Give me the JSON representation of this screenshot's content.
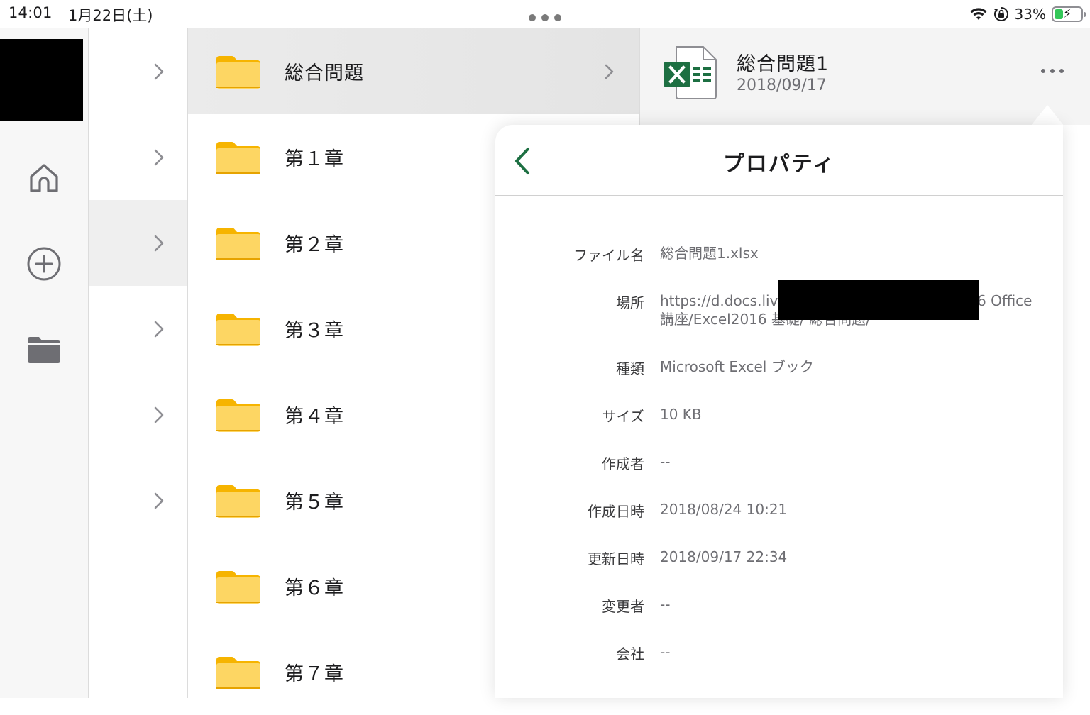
{
  "status_bar": {
    "time": "14:01",
    "date": "1月22日(土)",
    "battery_percent": "33%",
    "battery_level": 0.33,
    "battery_color": "#34c759",
    "icons": [
      "wifi-icon",
      "orientation-lock-icon",
      "battery-charging-icon"
    ]
  },
  "rail": {
    "icons": [
      "home-icon",
      "add-icon",
      "folder-icon"
    ]
  },
  "folders": [
    {
      "name": "総合問題"
    },
    {
      "name": "第１章"
    },
    {
      "name": "第２章"
    },
    {
      "name": "第３章"
    },
    {
      "name": "第４章"
    },
    {
      "name": "第５章"
    },
    {
      "name": "第６章"
    },
    {
      "name": "第７章"
    }
  ],
  "file": {
    "title": "総合問題1",
    "date": "2018/09/17",
    "icon": "excel-icon",
    "accent": "#1d6f42"
  },
  "properties": {
    "title": "プロパティ",
    "rows": [
      {
        "label": "ファイル名",
        "value": "総合問題1.xlsx"
      },
      {
        "label": "場所",
        "value": "https://d.docs.liv",
        "value_tail": "6 Office",
        "value_line2": "講座/Excel2016 基礎/ 総合問題/"
      },
      {
        "label": "種類",
        "value": "Microsoft Excel ブック"
      },
      {
        "label": "サイズ",
        "value": "10 KB"
      },
      {
        "label": "作成者",
        "value": "--"
      },
      {
        "label": "作成日時",
        "value": "2018/08/24 10:21"
      },
      {
        "label": "更新日時",
        "value": "2018/09/17 22:34"
      },
      {
        "label": "変更者",
        "value": "--"
      },
      {
        "label": "会社",
        "value": "--"
      }
    ]
  }
}
